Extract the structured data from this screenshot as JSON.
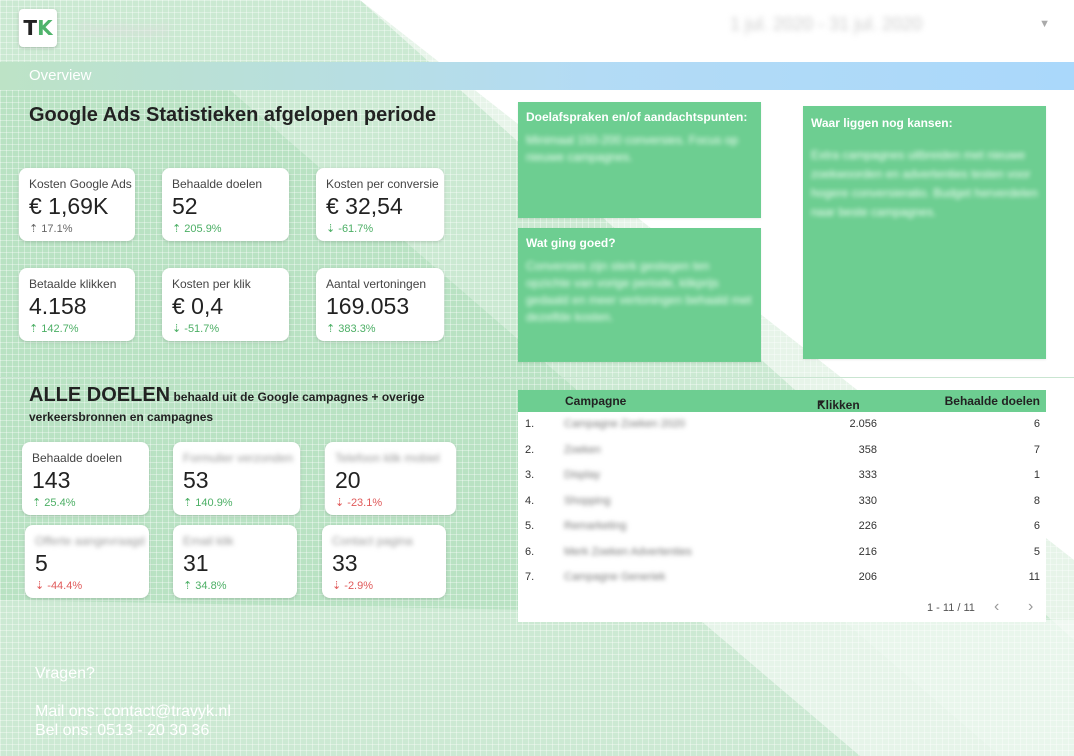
{
  "header": {
    "logo_text_t": "T",
    "logo_text_k": "K",
    "blurred_title": "Dashboard",
    "date_range": "1 jul. 2020 - 31 jul. 2020"
  },
  "overview": {
    "label": "Overview"
  },
  "google_ads": {
    "title": "Google Ads Statistieken afgelopen periode",
    "kpis": [
      {
        "label": "Kosten Google Ads",
        "value": "€ 1,69K",
        "change": "17.1%",
        "dir": "neutral"
      },
      {
        "label": "Behaalde doelen",
        "value": "52",
        "change": "205.9%",
        "dir": "up"
      },
      {
        "label": "Kosten per conversie",
        "value": "€ 32,54",
        "change": "-61.7%",
        "dir": "up-down"
      },
      {
        "label": "Betaalde klikken",
        "value": "4.158",
        "change": "142.7%",
        "dir": "up"
      },
      {
        "label": "Kosten per klik",
        "value": "€ 0,4",
        "change": "-51.7%",
        "dir": "up-down"
      },
      {
        "label": "Aantal vertoningen",
        "value": "169.053",
        "change": "383.3%",
        "dir": "up"
      }
    ]
  },
  "notes": {
    "afspraken_title": "Doelafspraken en/of aandachtspunten:",
    "afspraken_body": "Minimaal 150-200 conversies. Focus op nieuwe campagnes.",
    "goed_title": "Wat ging goed?",
    "goed_body": "Conversies zijn sterk gestegen ten opzichte van vorige periode, klikprijs gedaald en meer vertoningen behaald met dezelfde kosten.",
    "kansen_title": "Waar liggen nog kansen:",
    "kansen_body": "Extra campagnes uitbreiden met nieuwe zoekwoorden en advertenties testen voor hogere conversieratio. Budget herverdelen naar beste campagnes."
  },
  "alle_doelen": {
    "title_big": "ALLE DOELEN",
    "title_small": " behaald uit de Google campagnes + overige verkeersbronnen en campagnes",
    "kpis": [
      {
        "label": "Behaalde doelen",
        "value": "143",
        "change": "25.4%",
        "dir": "up",
        "blur": false
      },
      {
        "label": "Formulier verzonden",
        "value": "53",
        "change": "140.9%",
        "dir": "up",
        "blur": true
      },
      {
        "label": "Telefoon klik mobiel",
        "value": "20",
        "change": "-23.1%",
        "dir": "down",
        "blur": true
      },
      {
        "label": "Offerte aangevraagd",
        "value": "5",
        "change": "-44.4%",
        "dir": "down",
        "blur": true
      },
      {
        "label": "Email klik",
        "value": "31",
        "change": "34.8%",
        "dir": "up",
        "blur": true
      },
      {
        "label": "Contact pagina",
        "value": "33",
        "change": "-2.9%",
        "dir": "down",
        "blur": true
      }
    ]
  },
  "table": {
    "headers": {
      "campaign": "Campagne",
      "clicks": "Klikken",
      "goals": "Behaalde doelen"
    },
    "rows": [
      {
        "idx": "1.",
        "campaign": "Campagne Zoeken 2020",
        "clicks": "2.056",
        "goals": "6"
      },
      {
        "idx": "2.",
        "campaign": "Zoeken",
        "clicks": "358",
        "goals": "7"
      },
      {
        "idx": "3.",
        "campaign": "Display",
        "clicks": "333",
        "goals": "1"
      },
      {
        "idx": "4.",
        "campaign": "Shopping",
        "clicks": "330",
        "goals": "8"
      },
      {
        "idx": "5.",
        "campaign": "Remarketing",
        "clicks": "226",
        "goals": "6"
      },
      {
        "idx": "6.",
        "campaign": "Merk Zoeken Advertenties",
        "clicks": "216",
        "goals": "5"
      },
      {
        "idx": "7.",
        "campaign": "Campagne Generiek",
        "clicks": "206",
        "goals": "11"
      }
    ],
    "pager": "1 - 11 / 11"
  },
  "contact": {
    "question": "Vragen?",
    "mail": "Mail ons: contact@travyk.nl",
    "phone": "Bel ons: 0513 - 20 30 36"
  },
  "colors": {
    "accent_green": "#6dce91",
    "up": "#4caf65",
    "down": "#e05a5a",
    "overview_blue": "#aad8fb"
  }
}
